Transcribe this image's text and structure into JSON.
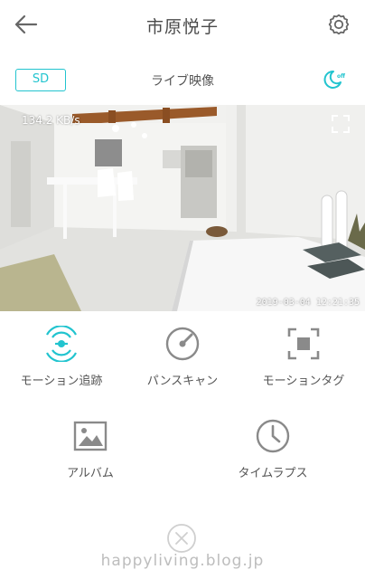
{
  "header": {
    "title": "市原悦子",
    "back_icon": "arrow-left-icon",
    "settings_icon": "gear-icon"
  },
  "subbar": {
    "sd_label": "SD",
    "live_label": "ライブ映像",
    "night_icon": "moon-off-icon"
  },
  "video": {
    "speed": "134.2 KB/s",
    "timestamp": "2019-03-04  12:21:35",
    "fullscreen_icon": "fullscreen-icon"
  },
  "features": [
    {
      "label": "モーション追跡",
      "icon": "motion-tracking-icon",
      "active": true
    },
    {
      "label": "パンスキャン",
      "icon": "pan-scan-icon",
      "active": false
    },
    {
      "label": "モーションタグ",
      "icon": "motion-tag-icon",
      "active": false
    },
    {
      "label": "アルバム",
      "icon": "album-icon",
      "active": false
    },
    {
      "label": "タイムラプス",
      "icon": "timelapse-icon",
      "active": false
    }
  ],
  "footer": {
    "close_icon": "close-icon",
    "watermark": "happyliving.blog.jp"
  },
  "colors": {
    "accent": "#22c4cf",
    "icon_gray": "#8a8a8a",
    "text": "#555555"
  }
}
